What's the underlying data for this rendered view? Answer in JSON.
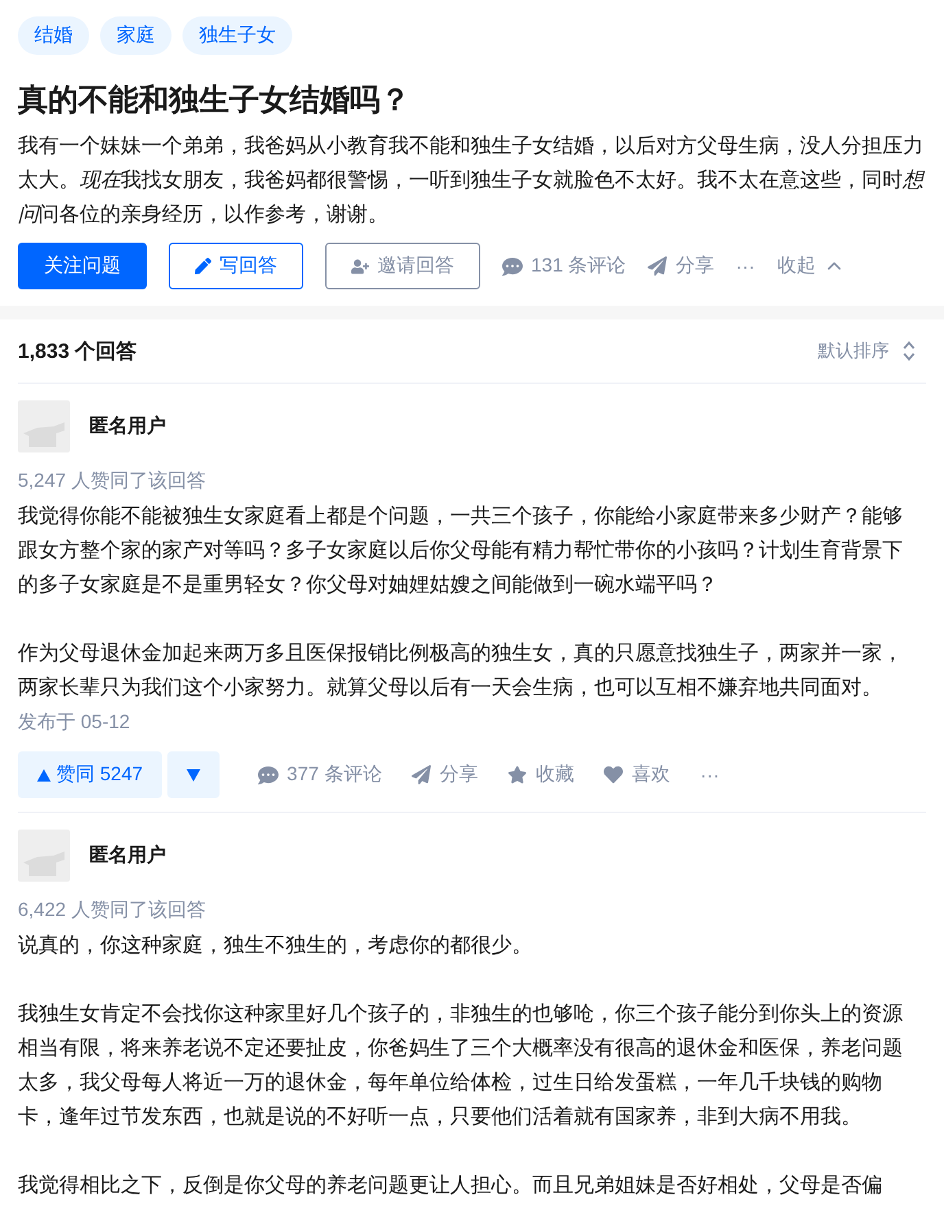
{
  "question": {
    "tags": [
      "结婚",
      "家庭",
      "独生子女"
    ],
    "title": "真的不能和独生子女结婚吗？",
    "description": [
      {
        "text": "我有一个妹妹一个弟弟，我爸妈从小教育我不能和独生子女结婚，以后对方父母生病，没人分担压力太大。",
        "italic": false
      },
      {
        "text": "现在",
        "italic": true
      },
      {
        "text": "我找女朋友，我爸妈都很警惕，一听到独生子女就脸色不太好。我不太在意这些，同时",
        "italic": false
      },
      {
        "text": "想问",
        "italic": true
      },
      {
        "text": "问各位的亲身经历，以作参考，谢谢。",
        "italic": false
      }
    ],
    "follow_button": "关注问题",
    "write_button": "写回答",
    "invite_button": "邀请回答",
    "comments": "131 条评论",
    "share": "分享",
    "more": "···",
    "collapse": "收起"
  },
  "answers_header": {
    "count": "1,833 个回答",
    "sort": "默认排序"
  },
  "answers": [
    {
      "author": "匿名用户",
      "upvoted_by": "5,247 人赞同了该回答",
      "paragraphs": [
        "我觉得你能不能被独生女家庭看上都是个问题，一共三个孩子，你能给小家庭带来多少财产？能够跟女方整个家的家产对等吗？多子女家庭以后你父母能有精力帮忙带你的小孩吗？计划生育背景下的多子女家庭是不是重男轻女？你父母对妯娌姑嫂之间能做到一碗水端平吗？",
        "作为父母退休金加起来两万多且医保报销比例极高的独生女，真的只愿意找独生子，两家并一家，两家长辈只为我们这个小家努力。就算父母以后有一天会生病，也可以互相不嫌弃地共同面对。"
      ],
      "published": "发布于 05-12",
      "actions": {
        "upvote": "赞同 5247",
        "comments": "377 条评论",
        "share": "分享",
        "favorite": "收藏",
        "like": "喜欢",
        "more": "···"
      }
    },
    {
      "author": "匿名用户",
      "upvoted_by": "6,422 人赞同了该回答",
      "paragraphs": [
        "说真的，你这种家庭，独生不独生的，考虑你的都很少。",
        "我独生女肯定不会找你这种家里好几个孩子的，非独生的也够呛，你三个孩子能分到你头上的资源相当有限，将来养老说不定还要扯皮，你爸妈生了三个大概率没有很高的退休金和医保，养老问题太多，我父母每人将近一万的退休金，每年单位给体检，过生日给发蛋糕，一年几千块钱的购物卡，逢年过节发东西，也就是说的不好听一点，只要他们活着就有国家养，非到大病不用我。",
        "我觉得相比之下，反倒是你父母的养老问题更让人担心。而且兄弟姐妹是否好相处，父母是否偏"
      ]
    }
  ]
}
